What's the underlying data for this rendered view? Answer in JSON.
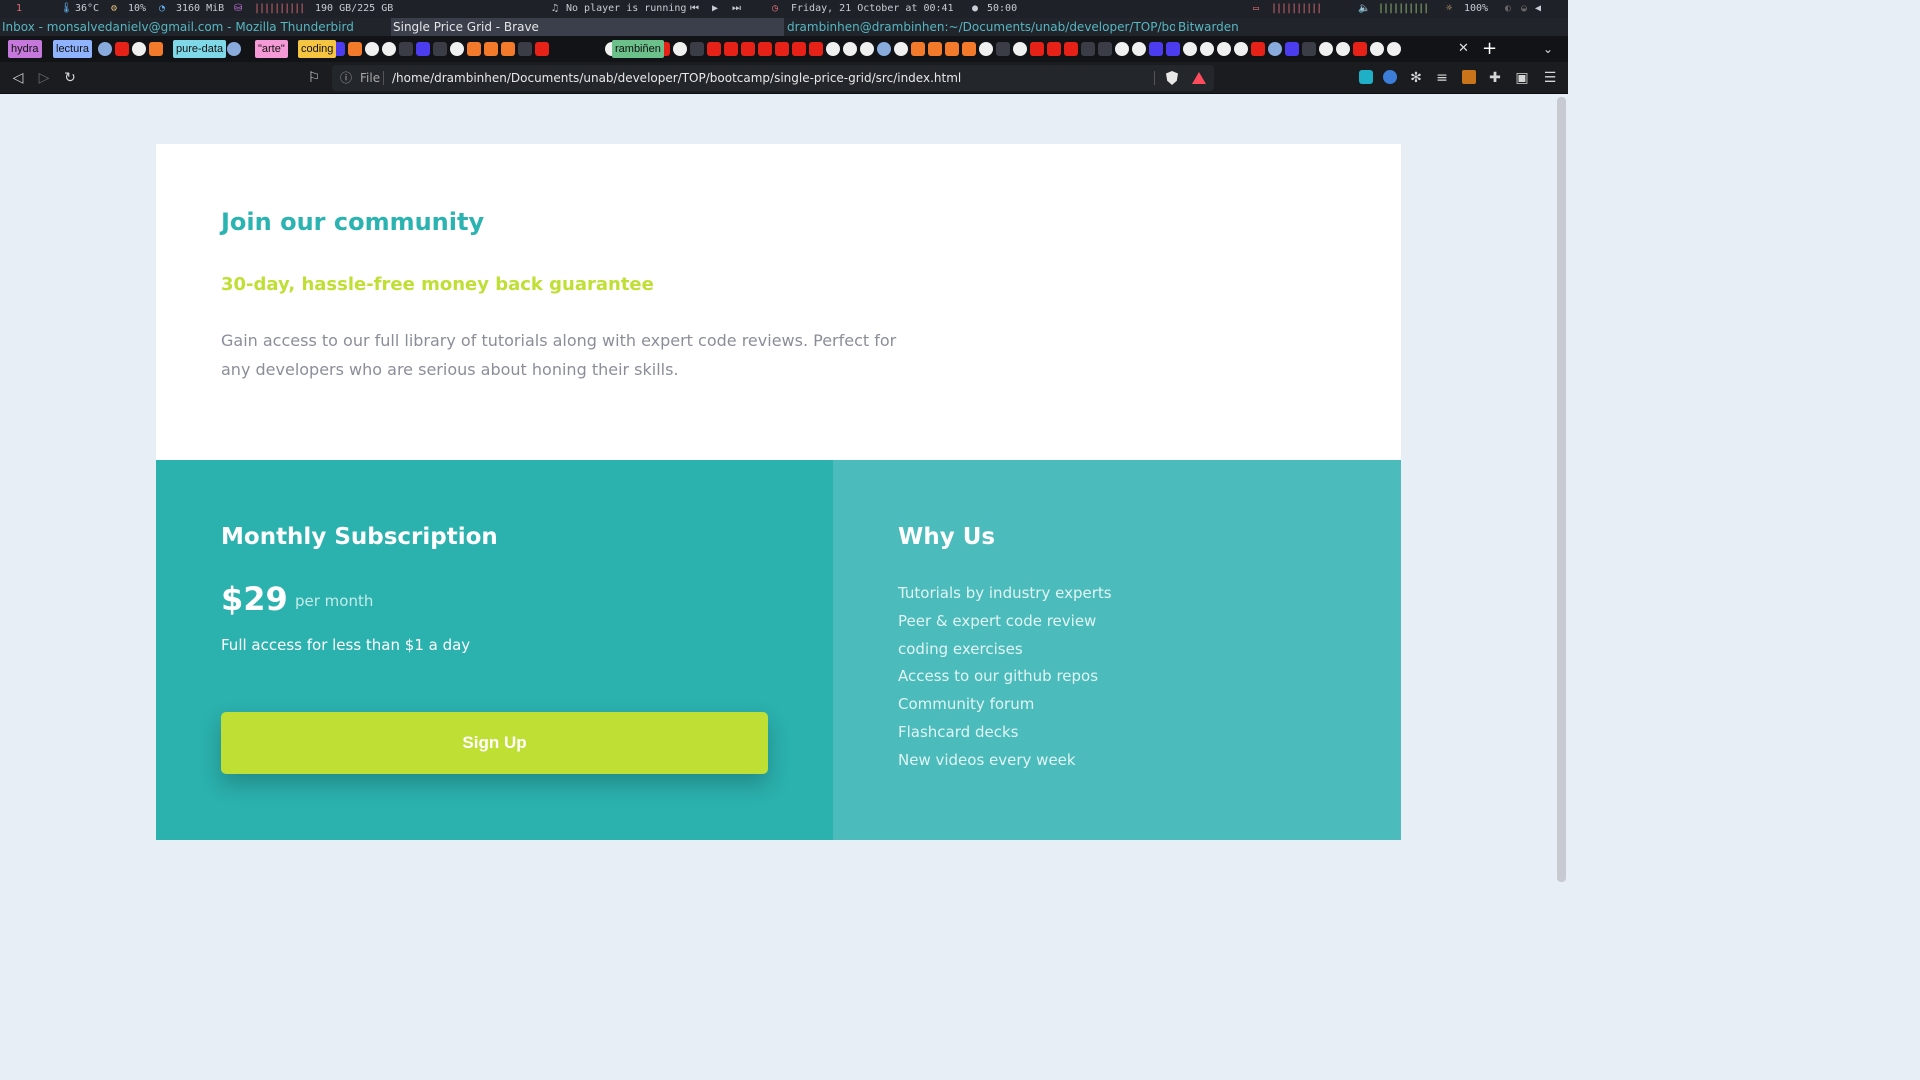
{
  "status_bar": {
    "workspace": "1",
    "temperature": "36°C",
    "cpu": "10%",
    "memory": "3160 MiB",
    "disk_bars": "||||||||||",
    "disk": "190 GB/225 GB",
    "player": "No player is running",
    "datetime": "Friday, 21 October at 00:41",
    "timer": "50:00",
    "battery_bars": "||||||||||",
    "volume_bars": "||||||||||",
    "brightness": "100%"
  },
  "window_titles": {
    "thunderbird": "Inbox - monsalvedanielv@gmail.com - Mozilla Thunderbird",
    "brave": "Single Price Grid - Brave",
    "terminal": "drambinhen@drambinhen:~/Documents/unab/developer/TOP/boot...",
    "bitwarden": "Bitwarden"
  },
  "tabs": {
    "groups": [
      {
        "label": "hydra",
        "color": "#c678dd"
      },
      {
        "label": "lectura",
        "color": "#8fb3ff"
      },
      {
        "label": "pure-data",
        "color": "#7fd8e8"
      },
      {
        "label": "\"arte\"",
        "color": "#f59ad6"
      },
      {
        "label": "coding",
        "color": "#f5c542"
      },
      {
        "label": "rambiñen",
        "color": "#6cc08a"
      }
    ],
    "close_symbol": "✕",
    "new_tab_symbol": "+"
  },
  "address_bar": {
    "scheme_label": "File",
    "url": "/home/drambinhen/Documents/unab/developer/TOP/bootcamp/single-price-grid/src/index.html"
  },
  "page": {
    "community_title": "Join our community",
    "guarantee": "30-day, hassle-free money back guarantee",
    "description": "Gain access to our full library of tutorials along with expert code reviews. Perfect for any developers who are serious about honing their skills.",
    "subscription": {
      "title": "Monthly Subscription",
      "price": "$29",
      "period": "per month",
      "tagline": "Full access for less than $1 a day",
      "button_label": "Sign Up"
    },
    "why_us": {
      "title": "Why Us",
      "items": [
        "Tutorials by industry experts",
        "Peer & expert code review",
        "coding exercises",
        "Access to our github repos",
        "Community forum",
        "Flashcard decks",
        "New videos every week"
      ]
    }
  },
  "colors": {
    "accent_cyan": "#2bb3b1",
    "accent_lime": "#bfdf35",
    "left_panel": "#2bb1ae",
    "right_panel": "#4bbbbb"
  }
}
